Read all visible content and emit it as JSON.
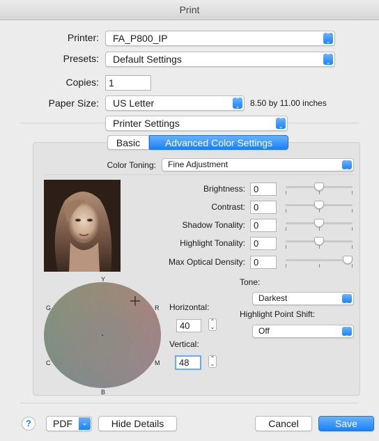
{
  "window": {
    "title": "Print"
  },
  "printer": {
    "label": "Printer:",
    "value": "FA_P800_IP"
  },
  "presets": {
    "label": "Presets:",
    "value": "Default Settings"
  },
  "copies": {
    "label": "Copies:",
    "value": "1"
  },
  "paper_size": {
    "label": "Paper Size:",
    "value": "US Letter",
    "dimensions": "8.50 by 11.00 inches"
  },
  "section_menu": {
    "value": "Printer Settings"
  },
  "tabs": [
    {
      "label": "Basic",
      "selected": false
    },
    {
      "label": "Advanced Color Settings",
      "selected": true
    }
  ],
  "color_toning": {
    "label": "Color Toning:",
    "value": "Fine Adjustment"
  },
  "adjustments": [
    {
      "label": "Brightness:",
      "value": "0",
      "level": 0.5
    },
    {
      "label": "Contrast:",
      "value": "0",
      "level": 0.5
    },
    {
      "label": "Shadow Tonality:",
      "value": "0",
      "level": 0.5
    },
    {
      "label": "Highlight Tonality:",
      "value": "0",
      "level": 0.5
    },
    {
      "label": "Max Optical Density:",
      "value": "0",
      "level": 1.0
    }
  ],
  "color_wheel": {
    "letters": {
      "top": "Y",
      "top_left": "G",
      "top_right": "R",
      "bottom_left": "C",
      "bottom_right": "M",
      "bottom": "B"
    }
  },
  "horizontal": {
    "label": "Horizontal:",
    "value": "40"
  },
  "vertical": {
    "label": "Vertical:",
    "value": "48"
  },
  "tone": {
    "label": "Tone:",
    "value": "Darkest"
  },
  "highlight_shift": {
    "label": "Highlight Point Shift:",
    "value": "Off"
  },
  "footer": {
    "help": "?",
    "pdf": "PDF",
    "hide_details": "Hide Details",
    "cancel": "Cancel",
    "save": "Save"
  },
  "colors": {
    "accent": "#1a82fb",
    "panel": "#e3e3e3",
    "window": "#ececec"
  }
}
